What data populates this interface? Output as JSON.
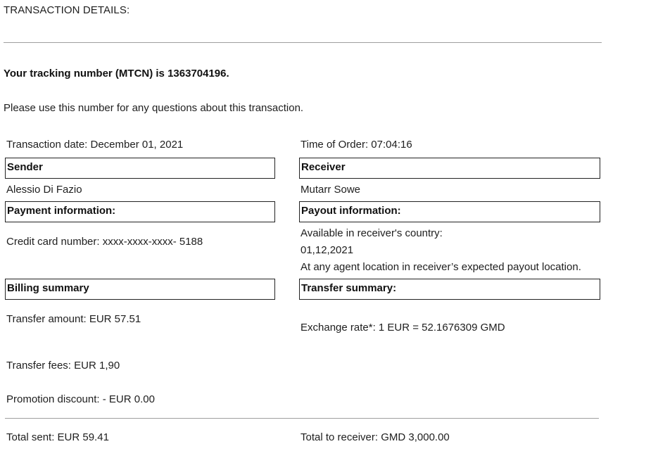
{
  "header": {
    "title": "TRANSACTION DETAILS:"
  },
  "tracking": {
    "message": "Your tracking number (MTCN) is 1363704196.",
    "note": "Please use this number for any questions about this transaction."
  },
  "meta": {
    "transaction_date": "Transaction date: December 01, 2021",
    "time_of_order": "Time of Order: 07:04:16"
  },
  "sender": {
    "heading": "Sender",
    "name": "Alessio Di Fazio"
  },
  "receiver": {
    "heading": "Receiver",
    "name": "Mutarr Sowe"
  },
  "payment": {
    "heading": "Payment information:",
    "card": "Credit card number: xxxx-xxxx-xxxx- 5188"
  },
  "payout": {
    "heading": "Payout information:",
    "line1": "Available in receiver's country:",
    "line2": "01,12,2021",
    "line3": "At any agent location in receiver’s expected payout location."
  },
  "billing": {
    "heading": "Billing summary",
    "transfer_amount": "Transfer amount: EUR 57.51",
    "transfer_fees": "Transfer fees: EUR 1,90",
    "promotion_discount": "Promotion discount: - EUR 0.00",
    "total_sent": "Total sent: EUR 59.41"
  },
  "transfer": {
    "heading": "Transfer summary:",
    "exchange_rate": "Exchange rate*: 1 EUR = 52.1676309 GMD",
    "total_to_receiver": "Total to receiver: GMD 3,000.00"
  }
}
